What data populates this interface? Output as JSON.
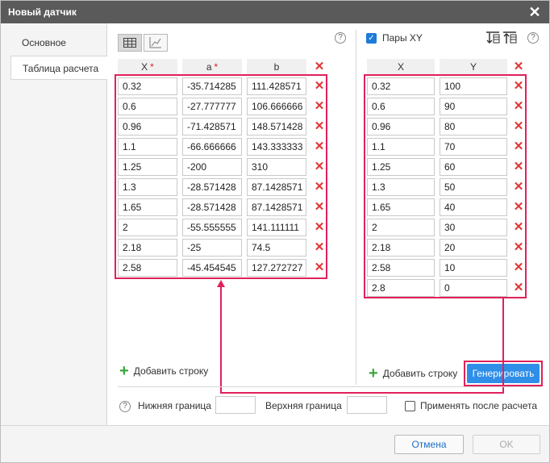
{
  "window": {
    "title": "Новый датчик",
    "close_label": "✕"
  },
  "sidebar": {
    "items": [
      {
        "label": "Основное"
      },
      {
        "label": "Таблица расчета"
      }
    ]
  },
  "left_table": {
    "columns": [
      {
        "label": "X",
        "required": true
      },
      {
        "label": "a",
        "required": true
      },
      {
        "label": "b",
        "required": false
      }
    ],
    "rows": [
      [
        "0.32",
        "-35.714285",
        "111.428571"
      ],
      [
        "0.6",
        "-27.777777",
        "106.666666"
      ],
      [
        "0.96",
        "-71.428571",
        "148.571428"
      ],
      [
        "1.1",
        "-66.666666",
        "143.333333"
      ],
      [
        "1.25",
        "-200",
        "310"
      ],
      [
        "1.3",
        "-28.571428",
        "87.1428571"
      ],
      [
        "1.65",
        "-28.571428",
        "87.1428571"
      ],
      [
        "2",
        "-55.555555",
        "141.111111"
      ],
      [
        "2.18",
        "-25",
        "74.5"
      ],
      [
        "2.58",
        "-45.454545",
        "127.272727"
      ]
    ],
    "add_row_label": "Добавить строку"
  },
  "right_table": {
    "pairs_label": "Пары XY",
    "pairs_checked": true,
    "columns": [
      {
        "label": "X"
      },
      {
        "label": "Y"
      }
    ],
    "rows": [
      [
        "0.32",
        "100"
      ],
      [
        "0.6",
        "90"
      ],
      [
        "0.96",
        "80"
      ],
      [
        "1.1",
        "70"
      ],
      [
        "1.25",
        "60"
      ],
      [
        "1.3",
        "50"
      ],
      [
        "1.65",
        "40"
      ],
      [
        "2",
        "30"
      ],
      [
        "2.18",
        "20"
      ],
      [
        "2.58",
        "10"
      ],
      [
        "2.8",
        "0"
      ]
    ],
    "add_row_label": "Добавить строку",
    "generate_label": "Генерировать"
  },
  "bounds": {
    "lower_label": "Нижняя граница",
    "lower_value": "",
    "upper_label": "Верхняя граница",
    "upper_value": "",
    "apply_label": "Применять после расчета",
    "apply_checked": false
  },
  "footer": {
    "cancel_label": "Отмена",
    "ok_label": "OK"
  },
  "icons": {
    "help": "?",
    "required_mark": "*",
    "delete": "✕",
    "checkmark": "✓",
    "plus": "+",
    "close": "close-icon",
    "table_view": "table-icon",
    "chart_view": "chart-icon",
    "sort_asc": "sort-ascending-icon",
    "sort_desc": "sort-descending-icon"
  },
  "colors": {
    "titlebar": "#5a5a5a",
    "accent": "#2f8ee8",
    "delete": "#e23333",
    "add": "#3aa63a",
    "highlight": "#e0215b",
    "link": "#1e6fc8"
  }
}
